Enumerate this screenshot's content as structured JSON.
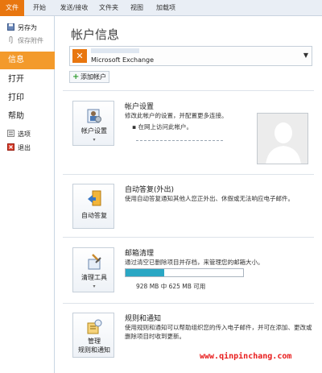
{
  "tabs": [
    "文件",
    "开始",
    "发送/接收",
    "文件夹",
    "视图",
    "加载项"
  ],
  "nav": {
    "save_as": "另存为",
    "save_attachments": "保存附件",
    "info": "信息",
    "open": "打开",
    "print": "打印",
    "help": "帮助",
    "options": "选项",
    "exit": "退出"
  },
  "page_title": "帐户信息",
  "account": {
    "type": "Microsoft Exchange",
    "add_button": "添加帐户"
  },
  "sections": {
    "account_settings": {
      "button_label": "帐户设置",
      "title": "帐户设置",
      "desc": "修改此帐户的设置，并配置更多连接。",
      "bullet": "在网上访问此帐户。"
    },
    "auto_reply": {
      "button_label": "自动答复",
      "title": "自动答复(外出)",
      "desc": "使用自动答复通知其他人您正外出、休假或无法响应电子邮件。"
    },
    "cleanup": {
      "button_label": "清理工具",
      "title": "邮箱清理",
      "desc": "通过清空已删除项目并存档，来管理您的邮箱大小。",
      "storage_text": "928 MB 中 625 MB 可用",
      "used_fraction": 0.33
    },
    "rules": {
      "button_label_1": "管理",
      "button_label_2": "规则和通知",
      "title": "规则和通知",
      "desc": "使用规则和通知可以帮助组织您的传入电子邮件，并可在添加、更改或删除项目时收到更新。"
    }
  },
  "watermark": "www.qinpinchang.com",
  "colors": {
    "file_tab": "#e8760f",
    "nav_active": "#f39a2b",
    "progress_fill": "#2aa7c4",
    "watermark": "#e81c1c"
  }
}
